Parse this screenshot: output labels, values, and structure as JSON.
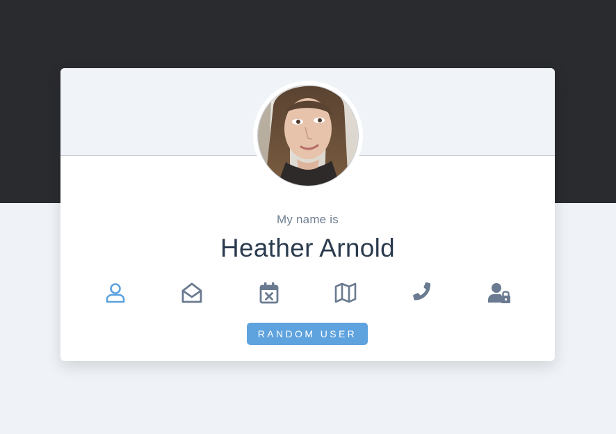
{
  "profile": {
    "label": "My name is",
    "name": "Heather Arnold"
  },
  "icons": [
    {
      "name": "user-icon",
      "active": true
    },
    {
      "name": "envelope-open-icon",
      "active": false
    },
    {
      "name": "calendar-x-icon",
      "active": false
    },
    {
      "name": "map-icon",
      "active": false
    },
    {
      "name": "phone-icon",
      "active": false
    },
    {
      "name": "user-lock-icon",
      "active": false
    }
  ],
  "button": {
    "label": "RANDOM USER"
  },
  "colors": {
    "dark_band": "#2a2b2f",
    "page_bg": "#eff3f7",
    "accent": "#5ea2de",
    "icon_default": "#6a7a90",
    "name_text": "#2b3b4e"
  }
}
